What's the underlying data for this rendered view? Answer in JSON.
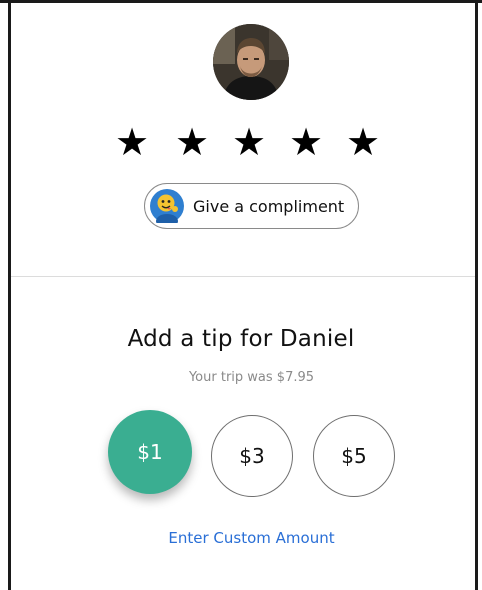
{
  "driver": {
    "avatar_icon": "driver-photo"
  },
  "rating": {
    "stars": [
      "★",
      "★",
      "★",
      "★",
      "★"
    ]
  },
  "compliment": {
    "icon": "emoji-compliment-icon",
    "label": "Give a compliment"
  },
  "tip": {
    "title": "Add a tip for Daniel",
    "subtitle": "Your trip was $7.95",
    "options": [
      {
        "label": "$1",
        "selected": true
      },
      {
        "label": "$3",
        "selected": false
      },
      {
        "label": "$5",
        "selected": false
      }
    ],
    "custom_link": "Enter Custom Amount"
  },
  "colors": {
    "accent": "#3aae91",
    "link": "#2a6fd6"
  }
}
